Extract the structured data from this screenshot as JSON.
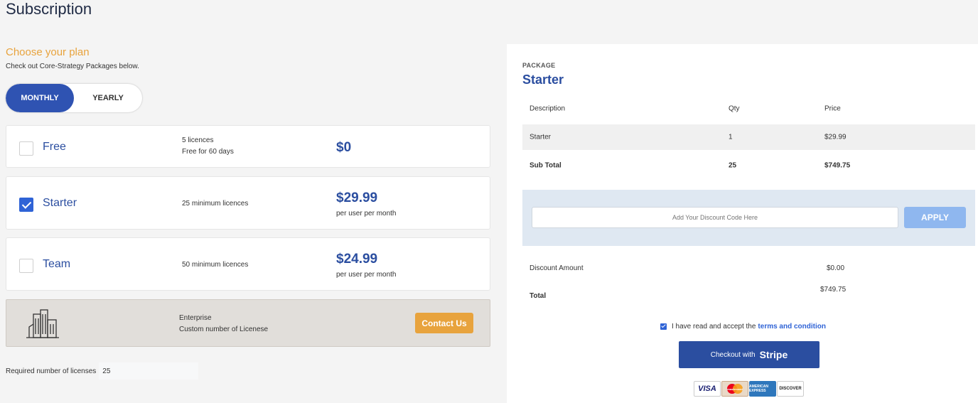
{
  "page": {
    "title": "Subscription"
  },
  "plans_section": {
    "heading": "Choose your plan",
    "subheading": "Check out Core-Strategy Packages below.",
    "billing_toggle": {
      "monthly": "MONTHLY",
      "yearly": "YEARLY",
      "selected": "MONTHLY"
    },
    "plans": [
      {
        "name": "Free",
        "desc1": "5 licences",
        "desc2": "Free for 60 days",
        "price": "$0",
        "per": "",
        "checked": false
      },
      {
        "name": "Starter",
        "desc1": "25 minimum licences",
        "desc2": "",
        "price": "$29.99",
        "per": "per user per month",
        "checked": true
      },
      {
        "name": "Team",
        "desc1": "50 minimum licences",
        "desc2": "",
        "price": "$24.99",
        "per": "per user per month",
        "checked": false
      }
    ],
    "enterprise": {
      "title": "Enterprise",
      "desc": "Custom number of Licenese",
      "button": "Contact Us"
    },
    "required_licenses": {
      "label": "Required number of licenses",
      "value": "25"
    }
  },
  "summary": {
    "package_label": "PACKAGE",
    "package_name": "Starter",
    "table": {
      "headers": [
        "Description",
        "Qty",
        "Price"
      ],
      "rows": [
        [
          "Starter",
          "1",
          "$29.99"
        ]
      ],
      "subtotal": [
        "Sub Total",
        "25",
        "$749.75"
      ]
    },
    "discount": {
      "placeholder": "Add Your Discount Code Here",
      "apply": "APPLY"
    },
    "discount_amount": {
      "label": "Discount Amount",
      "value": "$0.00"
    },
    "total": {
      "label": "Total",
      "value": "$749.75"
    },
    "accept": {
      "text": "I have read and accept the",
      "link": "terms and condition",
      "checked": true
    },
    "checkout": {
      "prefix": "Checkout with",
      "brand": "Stripe"
    },
    "cards": {
      "visa": "VISA",
      "mastercard": "mastercard",
      "amex": "AMERICAN EXPRESS",
      "discover": "DISCOVER"
    }
  },
  "colors": {
    "primary": "#2b4ea0",
    "accent": "#e8a33d",
    "apply": "#8fb7ef"
  }
}
